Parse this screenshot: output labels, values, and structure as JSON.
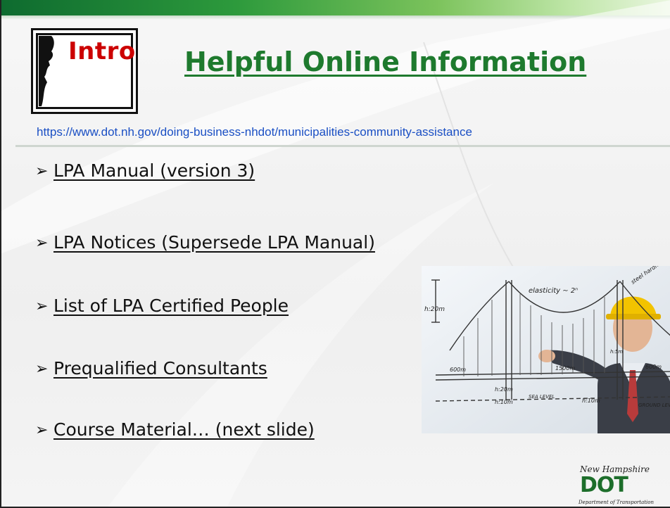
{
  "slide": {
    "badge": {
      "label": "Intro"
    },
    "title": "Helpful Online Information",
    "url": "https://www.dot.nh.gov/doing-business-nhdot/municipalities-community-assistance",
    "bullets": [
      {
        "label": "LPA Manual (version 3)"
      },
      {
        "label": "LPA Notices (Supersede LPA Manual)"
      },
      {
        "label": "List of LPA Certified People"
      },
      {
        "label": "Prequalified Consultants"
      },
      {
        "label": "Course Material… (next slide)"
      }
    ],
    "photo": {
      "labels": [
        "h:20m",
        "elasticity ∼ 2ⁿ",
        "steel hardness 3/2",
        "600m",
        "1500m",
        "600m",
        "h:20m",
        "h:10m",
        "SEA LEVEL",
        "h:10m",
        "GROUND LEVEL",
        "h:5m"
      ]
    },
    "logo": {
      "script": "New Hampshire",
      "word": "DOT",
      "tagline": "Department of Transportation"
    }
  },
  "colors": {
    "title": "#1e7a2e",
    "badge_text": "#cc0000",
    "url": "#1a4fc4",
    "top_bar": "#2d9a3c"
  },
  "icons": [
    "arrow-bullet-icon",
    "person-silhouette-icon"
  ]
}
